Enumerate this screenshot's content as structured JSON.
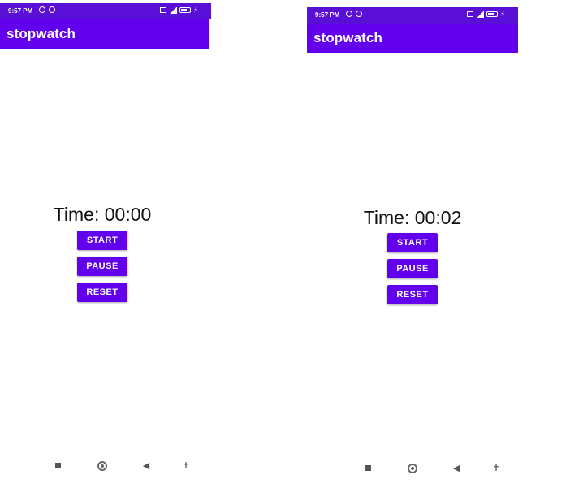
{
  "colors": {
    "status_bar": "#5a0fd6",
    "app_bar": "#6200ee",
    "button": "#6200ee"
  },
  "left_screen": {
    "status_bar": {
      "time": "9:57 PM"
    },
    "app_bar": {
      "title": "stopwatch"
    },
    "timer": {
      "text": "Time: 00:00"
    },
    "buttons": {
      "start": "START",
      "pause": "PAUSE",
      "reset": "RESET"
    },
    "nav_bar": {
      "icons": [
        "recents-icon",
        "home-icon",
        "back-icon",
        "accessibility-icon"
      ]
    }
  },
  "right_screen": {
    "status_bar": {
      "time": "9:57 PM"
    },
    "app_bar": {
      "title": "stopwatch"
    },
    "timer": {
      "text": "Time: 00:02"
    },
    "buttons": {
      "start": "START",
      "pause": "PAUSE",
      "reset": "RESET"
    },
    "nav_bar": {
      "icons": [
        "recents-icon",
        "home-icon",
        "back-icon",
        "accessibility-icon"
      ]
    }
  }
}
